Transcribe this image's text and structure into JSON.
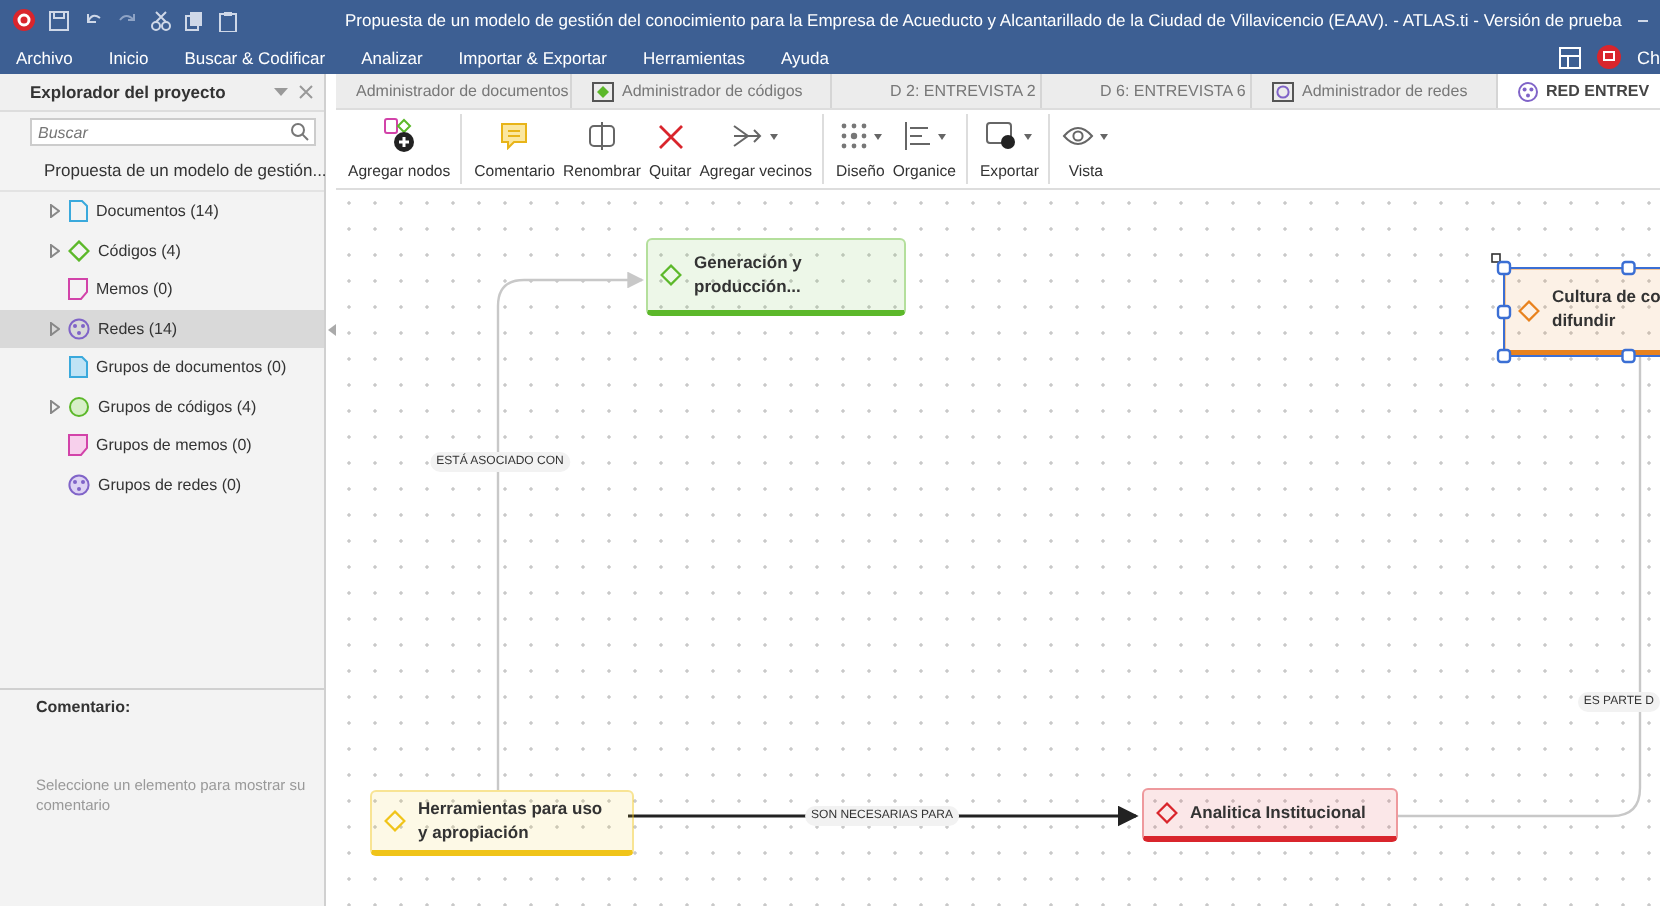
{
  "window": {
    "title": "Propuesta de un modelo de gestión del conocimiento para la Empresa de Acueducto y Alcantarillado de la Ciudad de Villavicencio (EAAV). - ATLAS.ti - Versión de prueba",
    "user_label": "Ch"
  },
  "menu": [
    "Archivo",
    "Inicio",
    "Buscar & Codificar",
    "Analizar",
    "Importar & Exportar",
    "Herramientas",
    "Ayuda"
  ],
  "tabs": [
    {
      "label": "Administrador de documentos",
      "kind": "none",
      "selected": false
    },
    {
      "label": "Administrador de códigos",
      "kind": "codes",
      "selected": false
    },
    {
      "label": "D 2: ENTREVISTA 2",
      "kind": "document",
      "selected": false
    },
    {
      "label": "D 6: ENTREVISTA 6",
      "kind": "document",
      "selected": false
    },
    {
      "label": "Administrador de redes",
      "kind": "networks",
      "selected": false
    },
    {
      "label": "RED ENTREV",
      "kind": "network",
      "selected": true
    }
  ],
  "toolbar": [
    {
      "label": "Agregar nodos",
      "kind": "add-nodes",
      "dropdown": false,
      "separator": true
    },
    {
      "label": "Comentario",
      "kind": "comment",
      "dropdown": false,
      "separator": false
    },
    {
      "label": "Renombrar",
      "kind": "rename",
      "dropdown": false,
      "separator": false
    },
    {
      "label": "Quitar",
      "kind": "remove",
      "dropdown": false,
      "separator": false
    },
    {
      "label": "Agregar vecinos",
      "kind": "neighbors",
      "dropdown": true,
      "separator": true
    },
    {
      "label": "Diseño",
      "kind": "layout",
      "dropdown": true,
      "separator": false
    },
    {
      "label": "Organice",
      "kind": "arrange",
      "dropdown": true,
      "separator": true
    },
    {
      "label": "Exportar",
      "kind": "export",
      "dropdown": true,
      "separator": true
    },
    {
      "label": "Vista",
      "kind": "view",
      "dropdown": true,
      "separator": false
    }
  ],
  "sidebar": {
    "title": "Explorador del proyecto",
    "search": {
      "placeholder": "Buscar"
    },
    "project": "Propuesta de un modelo de gestión...",
    "items": [
      {
        "label": "Documentos (14)",
        "kind": "documents",
        "expandable": true,
        "selected": false
      },
      {
        "label": "Códigos (4)",
        "kind": "codes",
        "expandable": true,
        "selected": false
      },
      {
        "label": "Memos (0)",
        "kind": "memos",
        "expandable": false,
        "selected": false
      },
      {
        "label": "Redes (14)",
        "kind": "networks",
        "expandable": true,
        "selected": true
      },
      {
        "label": "Grupos de documentos (0)",
        "kind": "document-groups",
        "expandable": false,
        "selected": false
      },
      {
        "label": "Grupos de códigos (4)",
        "kind": "code-groups",
        "expandable": true,
        "selected": false
      },
      {
        "label": "Grupos de memos (0)",
        "kind": "memo-groups",
        "expandable": false,
        "selected": false
      },
      {
        "label": "Grupos de redes (0)",
        "kind": "network-groups",
        "expandable": false,
        "selected": false
      }
    ],
    "comment": {
      "title": "Comentario:",
      "empty_message": "Seleccione un elemento para mostrar su comentario"
    }
  },
  "network": {
    "nodes": [
      {
        "label": "Generación y\nproducción...",
        "color": "#5cb82a",
        "selected": false
      },
      {
        "label": "Cultura de co\ndifundir",
        "color": "#e8821e",
        "selected": true
      },
      {
        "label": "Herramientas para uso\ny apropiación",
        "color": "#f0c419",
        "selected": false
      },
      {
        "label": "Analitica Institucional",
        "color": "#d9252c",
        "selected": false
      }
    ],
    "links": [
      {
        "label": "ESTÁ ASOCIADO CON"
      },
      {
        "label": "SON NECESARIAS PARA"
      },
      {
        "label": "ES PARTE D"
      }
    ]
  }
}
